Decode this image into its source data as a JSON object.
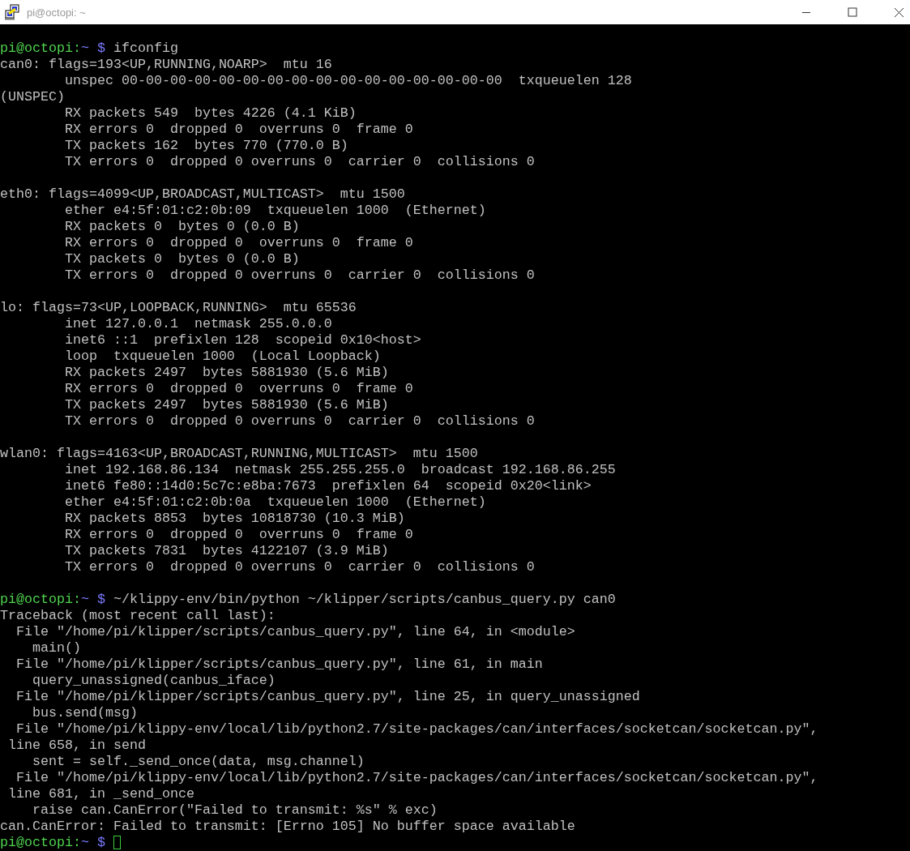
{
  "window": {
    "title": "pi@octopi: ~"
  },
  "terminal": {
    "lines": [
      {
        "kind": "prompt",
        "user_host": "pi@octopi:",
        "path": "~",
        "symbol": "$",
        "command": "ifconfig"
      },
      {
        "kind": "output",
        "text": "can0: flags=193<UP,RUNNING,NOARP>  mtu 16"
      },
      {
        "kind": "output",
        "text": "        unspec 00-00-00-00-00-00-00-00-00-00-00-00-00-00-00-00  txqueuelen 128"
      },
      {
        "kind": "output",
        "text": "(UNSPEC)"
      },
      {
        "kind": "output",
        "text": "        RX packets 549  bytes 4226 (4.1 KiB)"
      },
      {
        "kind": "output",
        "text": "        RX errors 0  dropped 0  overruns 0  frame 0"
      },
      {
        "kind": "output",
        "text": "        TX packets 162  bytes 770 (770.0 B)"
      },
      {
        "kind": "output",
        "text": "        TX errors 0  dropped 0 overruns 0  carrier 0  collisions 0"
      },
      {
        "kind": "blank"
      },
      {
        "kind": "output",
        "text": "eth0: flags=4099<UP,BROADCAST,MULTICAST>  mtu 1500"
      },
      {
        "kind": "output",
        "text": "        ether e4:5f:01:c2:0b:09  txqueuelen 1000  (Ethernet)"
      },
      {
        "kind": "output",
        "text": "        RX packets 0  bytes 0 (0.0 B)"
      },
      {
        "kind": "output",
        "text": "        RX errors 0  dropped 0  overruns 0  frame 0"
      },
      {
        "kind": "output",
        "text": "        TX packets 0  bytes 0 (0.0 B)"
      },
      {
        "kind": "output",
        "text": "        TX errors 0  dropped 0 overruns 0  carrier 0  collisions 0"
      },
      {
        "kind": "blank"
      },
      {
        "kind": "output",
        "text": "lo: flags=73<UP,LOOPBACK,RUNNING>  mtu 65536"
      },
      {
        "kind": "output",
        "text": "        inet 127.0.0.1  netmask 255.0.0.0"
      },
      {
        "kind": "output",
        "text": "        inet6 ::1  prefixlen 128  scopeid 0x10<host>"
      },
      {
        "kind": "output",
        "text": "        loop  txqueuelen 1000  (Local Loopback)"
      },
      {
        "kind": "output",
        "text": "        RX packets 2497  bytes 5881930 (5.6 MiB)"
      },
      {
        "kind": "output",
        "text": "        RX errors 0  dropped 0  overruns 0  frame 0"
      },
      {
        "kind": "output",
        "text": "        TX packets 2497  bytes 5881930 (5.6 MiB)"
      },
      {
        "kind": "output",
        "text": "        TX errors 0  dropped 0 overruns 0  carrier 0  collisions 0"
      },
      {
        "kind": "blank"
      },
      {
        "kind": "output",
        "text": "wlan0: flags=4163<UP,BROADCAST,RUNNING,MULTICAST>  mtu 1500"
      },
      {
        "kind": "output",
        "text": "        inet 192.168.86.134  netmask 255.255.255.0  broadcast 192.168.86.255"
      },
      {
        "kind": "output",
        "text": "        inet6 fe80::14d0:5c7c:e8ba:7673  prefixlen 64  scopeid 0x20<link>"
      },
      {
        "kind": "output",
        "text": "        ether e4:5f:01:c2:0b:0a  txqueuelen 1000  (Ethernet)"
      },
      {
        "kind": "output",
        "text": "        RX packets 8853  bytes 10818730 (10.3 MiB)"
      },
      {
        "kind": "output",
        "text": "        RX errors 0  dropped 0  overruns 0  frame 0"
      },
      {
        "kind": "output",
        "text": "        TX packets 7831  bytes 4122107 (3.9 MiB)"
      },
      {
        "kind": "output",
        "text": "        TX errors 0  dropped 0 overruns 0  carrier 0  collisions 0"
      },
      {
        "kind": "blank"
      },
      {
        "kind": "prompt",
        "user_host": "pi@octopi:",
        "path": "~",
        "symbol": "$",
        "command": "~/klippy-env/bin/python ~/klipper/scripts/canbus_query.py can0"
      },
      {
        "kind": "output",
        "text": "Traceback (most recent call last):"
      },
      {
        "kind": "output",
        "text": "  File \"/home/pi/klipper/scripts/canbus_query.py\", line 64, in <module>"
      },
      {
        "kind": "output",
        "text": "    main()"
      },
      {
        "kind": "output",
        "text": "  File \"/home/pi/klipper/scripts/canbus_query.py\", line 61, in main"
      },
      {
        "kind": "output",
        "text": "    query_unassigned(canbus_iface)"
      },
      {
        "kind": "output",
        "text": "  File \"/home/pi/klipper/scripts/canbus_query.py\", line 25, in query_unassigned"
      },
      {
        "kind": "output",
        "text": "    bus.send(msg)"
      },
      {
        "kind": "output",
        "text": "  File \"/home/pi/klippy-env/local/lib/python2.7/site-packages/can/interfaces/socketcan/socketcan.py\","
      },
      {
        "kind": "output",
        "text": " line 658, in send"
      },
      {
        "kind": "output",
        "text": "    sent = self._send_once(data, msg.channel)"
      },
      {
        "kind": "output",
        "text": "  File \"/home/pi/klippy-env/local/lib/python2.7/site-packages/can/interfaces/socketcan/socketcan.py\","
      },
      {
        "kind": "output",
        "text": " line 681, in _send_once"
      },
      {
        "kind": "output",
        "text": "    raise can.CanError(\"Failed to transmit: %s\" % exc)"
      },
      {
        "kind": "output",
        "text": "can.CanError: Failed to transmit: [Errno 105] No buffer space available"
      },
      {
        "kind": "prompt",
        "user_host": "pi@octopi:",
        "path": "~",
        "symbol": "$",
        "cursor": true
      }
    ]
  }
}
